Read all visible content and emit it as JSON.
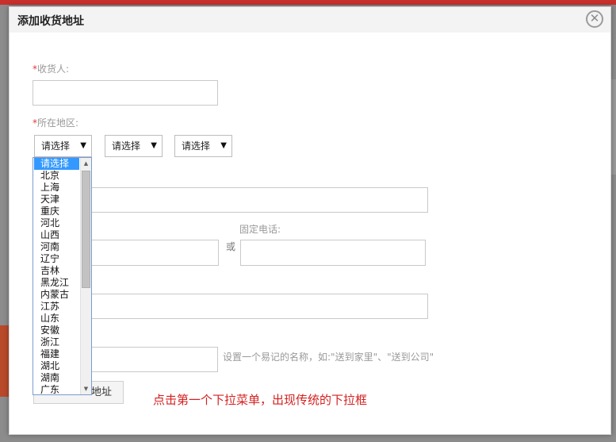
{
  "dialog": {
    "title": "添加收货地址",
    "close_glyph": "✕"
  },
  "form": {
    "required_mark": "*",
    "recipient_label": "收货人:",
    "region_label": "所在地区:",
    "selects": [
      {
        "value": "请选择"
      },
      {
        "value": "请选择"
      },
      {
        "value": "请选择"
      }
    ],
    "landline_label": "固定电话:",
    "or_text": "或",
    "alias_hint": "设置一个易记的名称，如:\"送到家里\"、\"送到公司\"",
    "submit_label": "地址"
  },
  "dropdown": {
    "selected_index": 0,
    "options": [
      "请选择",
      "北京",
      "上海",
      "天津",
      "重庆",
      "河北",
      "山西",
      "河南",
      "辽宁",
      "吉林",
      "黑龙江",
      "内蒙古",
      "江苏",
      "山东",
      "安徽",
      "浙江",
      "福建",
      "湖北",
      "湖南",
      "广东"
    ],
    "scroll_up_glyph": "▲",
    "scroll_down_glyph": "▼"
  },
  "annotation": "点击第一个下拉菜单，出现传统的下拉框",
  "colors": {
    "required": "#e4393c",
    "annotation": "#d42020",
    "selected_option_bg": "#3399ff"
  }
}
